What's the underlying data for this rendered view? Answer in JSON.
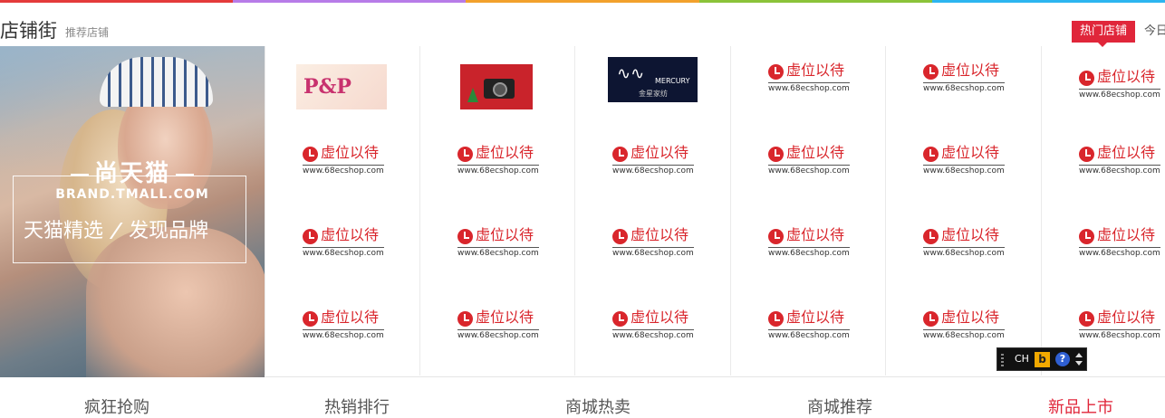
{
  "top_stripe_colors": [
    "#e43b3b",
    "#b77be8",
    "#f2a12c",
    "#8bc33a",
    "#2cb5f0"
  ],
  "header": {
    "title": "店铺街",
    "subtitle": "推荐店铺",
    "tabs": [
      {
        "label": "热门店铺",
        "active": true
      },
      {
        "label": "今日"
      }
    ]
  },
  "banner": {
    "brand_cn": "尚天猫",
    "brand_en": "BRAND.TMALL.COM",
    "slogan_left": "天猫精选",
    "slogan_sep": "/",
    "slogan_right": "发现品牌"
  },
  "placeholder": {
    "text": "虚位以待",
    "url": "www.68ecshop.com"
  },
  "shops": {
    "shop1": {
      "text": "P&P"
    },
    "shop3": {
      "wordmark": "MERCURY",
      "cn": "金星家纺"
    }
  },
  "bottom_nav": [
    {
      "label": "疯狂抢购"
    },
    {
      "label": "热销排行"
    },
    {
      "label": "商城热卖"
    },
    {
      "label": "商城推荐"
    },
    {
      "label": "新品上市",
      "active": true
    }
  ],
  "ime_toolbar": {
    "lang": "CH",
    "b_label": "b",
    "help_label": "?"
  },
  "colors": {
    "accent": "#e0263a",
    "placeholder_red": "#d9262c"
  }
}
